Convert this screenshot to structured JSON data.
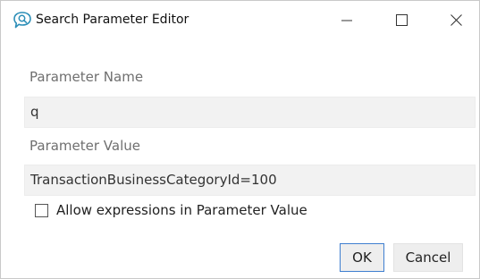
{
  "window": {
    "title": "Search Parameter Editor",
    "icon": "search-parameter-icon",
    "accent_color": "#2d8fb8"
  },
  "titlebar_controls": {
    "minimize": "minimize-icon",
    "maximize": "maximize-icon",
    "close": "close-icon"
  },
  "form": {
    "parameter_name": {
      "label": "Parameter Name",
      "value": "q"
    },
    "parameter_value": {
      "label": "Parameter Value",
      "value": "TransactionBusinessCategoryId=100"
    },
    "allow_expressions": {
      "label": "Allow expressions in Parameter Value",
      "checked": false
    }
  },
  "buttons": {
    "ok": "OK",
    "cancel": "Cancel"
  }
}
